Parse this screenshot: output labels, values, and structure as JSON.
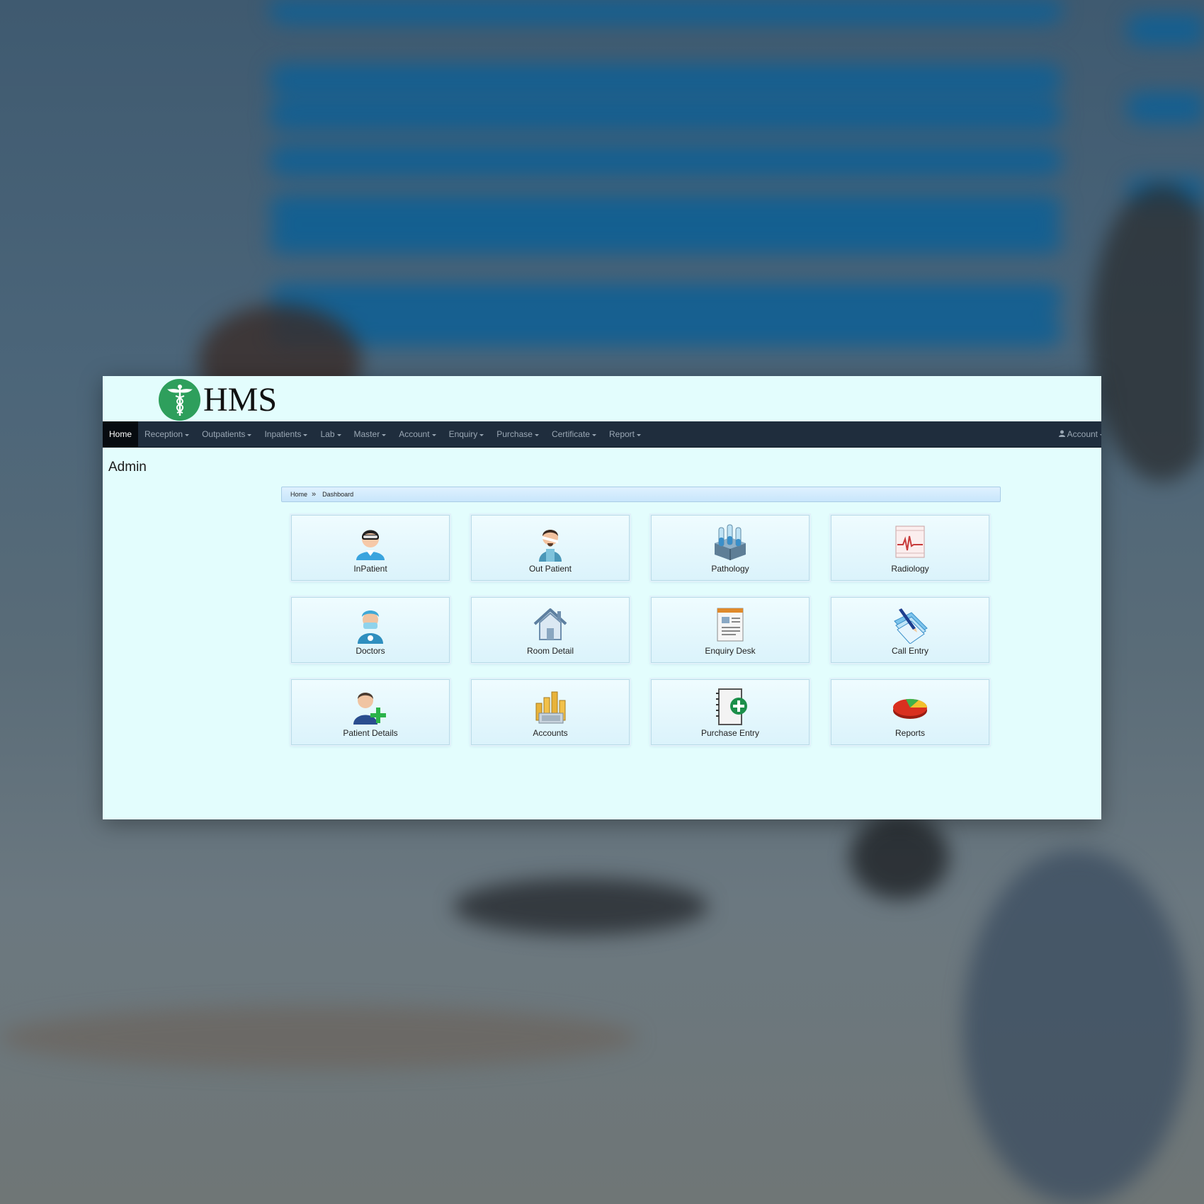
{
  "app": {
    "logo_text": "HMS",
    "brand_color": "#2e9f5c"
  },
  "navbar": {
    "items": [
      {
        "label": "Home",
        "active": true,
        "dropdown": false
      },
      {
        "label": "Reception",
        "dropdown": true
      },
      {
        "label": "Outpatients",
        "dropdown": true
      },
      {
        "label": "Inpatients",
        "dropdown": true
      },
      {
        "label": "Lab",
        "dropdown": true
      },
      {
        "label": "Master",
        "dropdown": true
      },
      {
        "label": "Account",
        "dropdown": true
      },
      {
        "label": "Enquiry",
        "dropdown": true
      },
      {
        "label": "Purchase",
        "dropdown": true
      },
      {
        "label": "Certificate",
        "dropdown": true
      },
      {
        "label": "Report",
        "dropdown": true
      }
    ],
    "user_menu": {
      "label": "Account",
      "icon": "user-icon"
    },
    "background": "#1f2d3d"
  },
  "page": {
    "title": "Admin"
  },
  "breadcrumb": {
    "items": [
      "Home",
      "Dashboard"
    ]
  },
  "tiles": [
    {
      "label": "InPatient",
      "icon": "inpatient-icon"
    },
    {
      "label": "Out Patient",
      "icon": "outpatient-icon"
    },
    {
      "label": "Pathology",
      "icon": "pathology-icon"
    },
    {
      "label": "Radiology",
      "icon": "radiology-icon"
    },
    {
      "label": "Doctors",
      "icon": "doctor-icon"
    },
    {
      "label": "Room Detail",
      "icon": "house-icon"
    },
    {
      "label": "Enquiry Desk",
      "icon": "document-icon"
    },
    {
      "label": "Call Entry",
      "icon": "notepad-pen-icon"
    },
    {
      "label": "Patient Details",
      "icon": "add-user-icon"
    },
    {
      "label": "Accounts",
      "icon": "coins-icon"
    },
    {
      "label": "Purchase Entry",
      "icon": "notebook-plus-icon"
    },
    {
      "label": "Reports",
      "icon": "pie-chart-icon"
    }
  ]
}
